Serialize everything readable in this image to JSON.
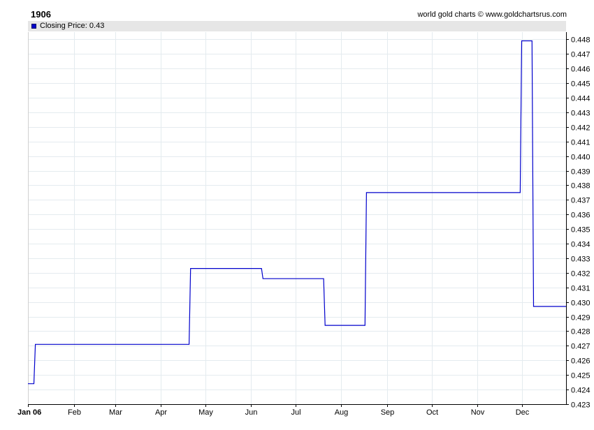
{
  "chart_data": {
    "type": "line",
    "title": "1906",
    "credit": "world gold charts © www.goldchartsrus.com",
    "legend": {
      "text": "Closing Price: 0.43",
      "color": "#0000cc",
      "placement": "top"
    },
    "series": [
      {
        "color": "#0000cc",
        "x": [
          "1906-01-01",
          "1906-01-05",
          "1906-01-06",
          "1906-04-20",
          "1906-04-21",
          "1906-06-08",
          "1906-06-09",
          "1906-07-20",
          "1906-07-21",
          "1906-08-17",
          "1906-08-18",
          "1906-11-30",
          "1906-12-01",
          "1906-12-08",
          "1906-12-09",
          "1906-12-31"
        ],
        "y": [
          0.4244,
          0.4244,
          0.4271,
          0.4271,
          0.4323,
          0.4323,
          0.4316,
          0.4316,
          0.4284,
          0.4284,
          0.4375,
          0.4375,
          0.4479,
          0.4479,
          0.4297,
          0.4297
        ]
      }
    ],
    "x_axis": {
      "range": [
        "1906-01-01",
        "1906-12-31"
      ],
      "ticks": [
        {
          "label": "Jan 06",
          "date": "1906-01-01",
          "bold": true
        },
        {
          "label": "Feb",
          "date": "1906-02-01"
        },
        {
          "label": "Mar",
          "date": "1906-03-01"
        },
        {
          "label": "Apr",
          "date": "1906-04-01"
        },
        {
          "label": "May",
          "date": "1906-05-01"
        },
        {
          "label": "Jun",
          "date": "1906-06-01"
        },
        {
          "label": "Jul",
          "date": "1906-07-01"
        },
        {
          "label": "Aug",
          "date": "1906-08-01"
        },
        {
          "label": "Sep",
          "date": "1906-09-01"
        },
        {
          "label": "Oct",
          "date": "1906-10-01"
        },
        {
          "label": "Nov",
          "date": "1906-11-01"
        },
        {
          "label": "Dec",
          "date": "1906-12-01"
        }
      ]
    },
    "y_axis": {
      "range": [
        0.423,
        0.4485
      ],
      "position": "right",
      "ticks": [
        "0.423",
        "0.424",
        "0.425",
        "0.426",
        "0.427",
        "0.428",
        "0.429",
        "0.430",
        "0.431",
        "0.432",
        "0.433",
        "0.434",
        "0.435",
        "0.436",
        "0.437",
        "0.438",
        "0.439",
        "0.440",
        "0.441",
        "0.442",
        "0.443",
        "0.444",
        "0.445",
        "0.446",
        "0.447",
        "0.448"
      ]
    },
    "grid": true
  }
}
